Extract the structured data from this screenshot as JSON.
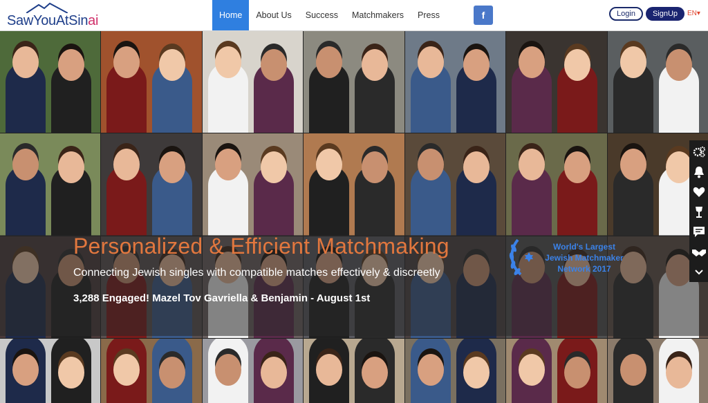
{
  "brand": {
    "logo_text_main": "SawYouAtSin",
    "logo_text_accent": "ai"
  },
  "nav": {
    "items": [
      {
        "label": "Home",
        "active": true
      },
      {
        "label": "About Us",
        "active": false
      },
      {
        "label": "Success",
        "active": false
      },
      {
        "label": "Matchmakers",
        "active": false
      },
      {
        "label": "Press",
        "active": false
      }
    ]
  },
  "social": {
    "facebook_label": "f"
  },
  "auth": {
    "login_label": "Login",
    "signup_label": "SignUp"
  },
  "language": {
    "selected": "EN▾"
  },
  "hero": {
    "title": "Personalized & Efficient Matchmaking",
    "subtitle": "Connecting Jewish singles with compatible matches effectively & discreetly",
    "news": "3,288 Engaged! Mazel Tov Gavriella & Benjamin - August 1st"
  },
  "award": {
    "line1": "World's Largest",
    "line2": "Jewish Matchmaker",
    "line3": "Network 2017"
  },
  "sidebar_icons": [
    "gears-icon",
    "bell-icon",
    "heart-icon",
    "wine-glass-icon",
    "chat-icon",
    "handshake-icon",
    "chevron-down-icon"
  ],
  "colors": {
    "accent_blue": "#2f7fe0",
    "title_orange": "#e2773e",
    "navy": "#1a2470",
    "award_blue": "#3b82e8"
  }
}
